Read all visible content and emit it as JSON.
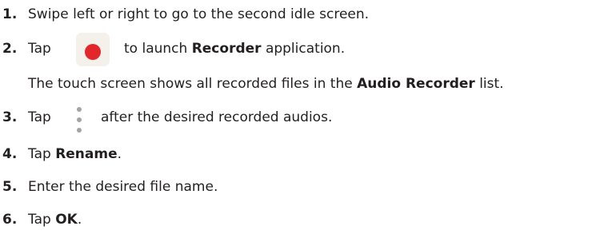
{
  "steps": [
    {
      "number": "1.",
      "text": "Swipe left or right to go to the second idle screen."
    },
    {
      "number": "2.",
      "pre": "Tap",
      "post": "to launch",
      "bold": "Recorder",
      "tail": "application.",
      "icon": "recorder-icon"
    },
    {
      "note_pre": "The touch screen shows all recorded files in the",
      "note_bold": "Audio Recorder",
      "note_post": "list."
    },
    {
      "number": "3.",
      "pre": "Tap",
      "post": "after the desired recorded audios.",
      "icon": "more-options-icon"
    },
    {
      "number": "4.",
      "pre": "Tap",
      "bold": "Rename",
      "tail": "."
    },
    {
      "number": "5.",
      "text": "Enter the desired file name."
    },
    {
      "number": "6.",
      "pre": "Tap",
      "bold": "OK",
      "tail": "."
    }
  ],
  "colors": {
    "text": "#231f20",
    "recorder_dot": "#e3262a",
    "recorder_bg": "#f4f1eb",
    "more_dots": "#a4a4a4"
  }
}
